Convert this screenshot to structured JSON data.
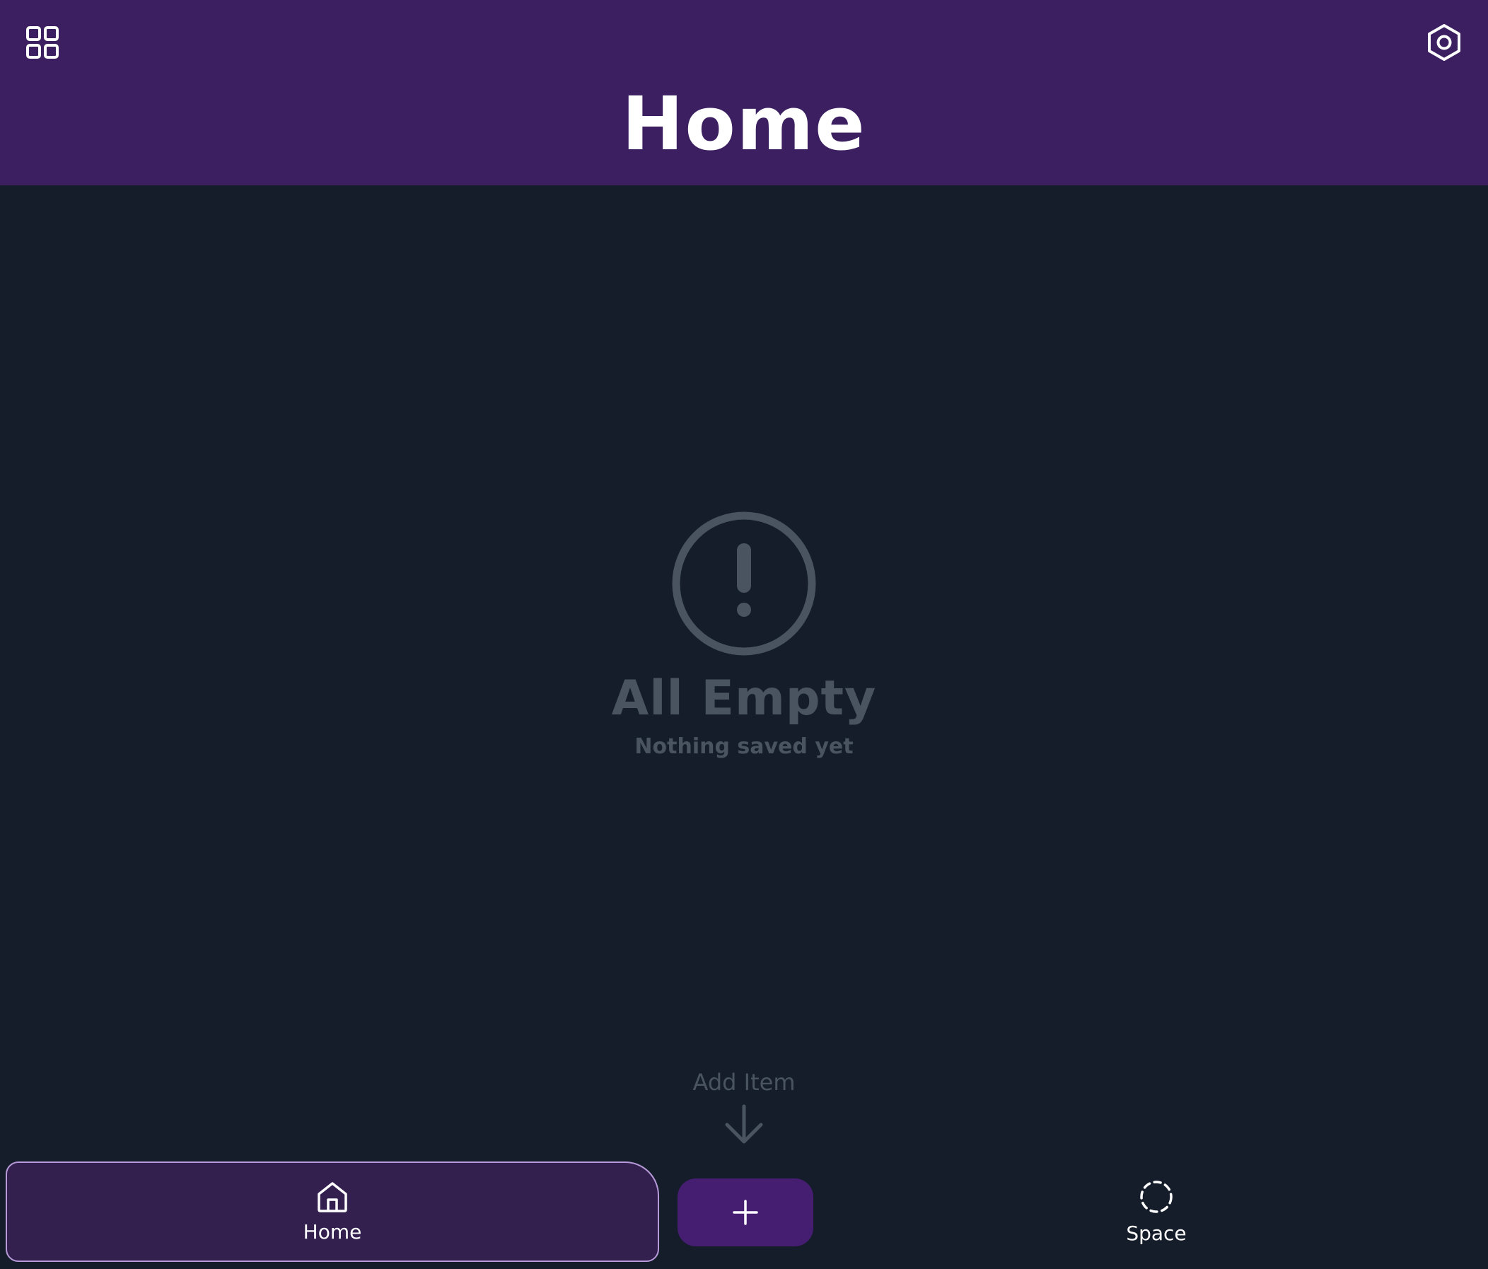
{
  "header": {
    "title": "Home",
    "apps_icon": "grid-icon",
    "settings_icon": "hexagon-gear-icon"
  },
  "empty_state": {
    "icon": "alert-circle-icon",
    "title": "All Empty",
    "subtitle": "Nothing saved yet"
  },
  "hint": {
    "label": "Add Item",
    "icon": "arrow-down-icon"
  },
  "bottom_nav": {
    "home": {
      "label": "Home",
      "icon": "home-icon",
      "active": true
    },
    "add": {
      "icon": "plus-icon"
    },
    "space": {
      "label": "Space",
      "icon": "dashed-circle-icon"
    }
  },
  "colors": {
    "header_bg": "#3b1f61",
    "page_bg": "#151d2b",
    "muted": "#4a5461",
    "active_tab_bg": "#33204f",
    "active_tab_border": "#b79ad8",
    "add_button_bg": "#451d71",
    "text_primary": "#ffffff"
  }
}
